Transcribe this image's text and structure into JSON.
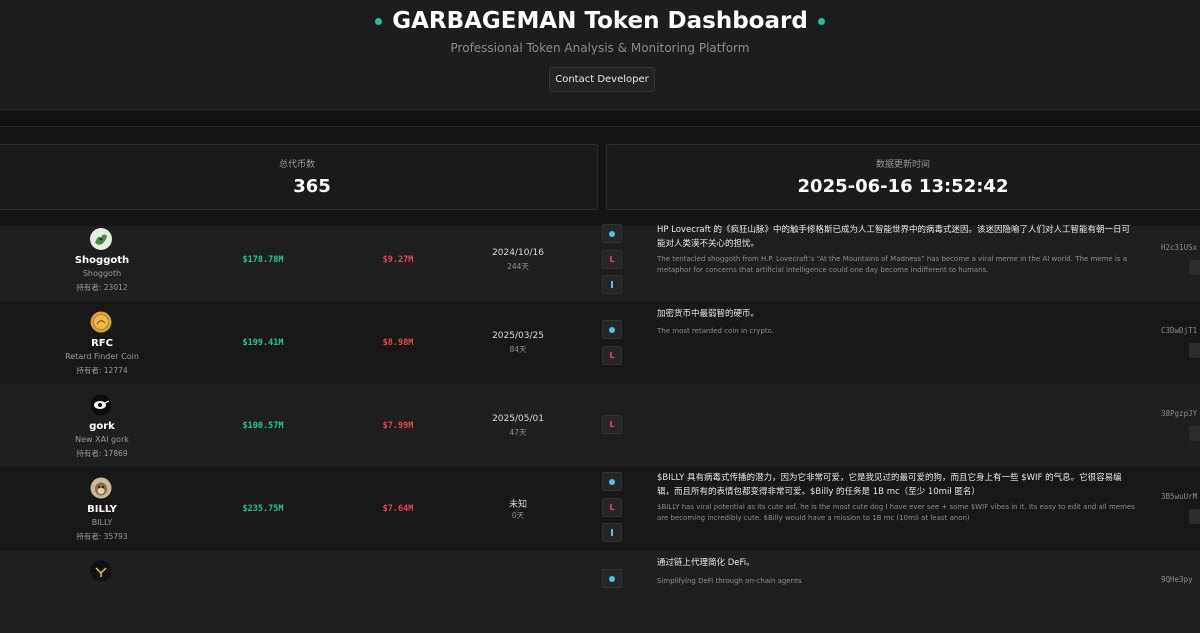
{
  "header": {
    "title": "GARBAGEMAN Token Dashboard",
    "subtitle": "Professional Token Analysis & Monitoring Platform",
    "contact_label": "Contact Developer"
  },
  "stats": {
    "total_label": "总代币数",
    "total_value": "365",
    "updated_label": "数据更新时间",
    "updated_value": "2025-06-16 13:52:42"
  },
  "colors": {
    "accent": "#19c29a",
    "market_cap": "#21c98b",
    "volume": "#e8464f",
    "link_blue": "#4ec6ec"
  },
  "tokens": [
    {
      "name": "Shoggoth",
      "subname": "Shoggoth",
      "holders": "持有者: 23012",
      "market_cap": "$178.78M",
      "volume": "$9.27M",
      "date": "2024/10/16",
      "days": "244天",
      "links": [
        "website-icon",
        "x-icon",
        "telegram-icon"
      ],
      "desc_cn": "HP Lovecraft 的《疯狂山脉》中的触手修格斯已成为人工智能世界中的病毒式迷因。该迷因隐喻了人们对人工智能有朝一日可能对人类漠不关心的担忧。",
      "desc_en": "The tentacled shoggoth from H.P. Lovecraft’s “At the Mountains of Madness” has become a viral meme in the AI world. The meme is a metaphor for concerns that artificial intelligence could one day become indifferent to humans.",
      "address": "H2c31USx"
    },
    {
      "name": "RFC",
      "subname": "Retard Finder Coin",
      "holders": "持有者: 12774",
      "market_cap": "$199.41M",
      "volume": "$8.98M",
      "date": "2025/03/25",
      "days": "84天",
      "links": [
        "website-icon",
        "x-icon"
      ],
      "desc_cn": "加密货币中最弱智的硬币。",
      "desc_en": "The most retarded coin in crypto.",
      "address": "C3DwDjT1"
    },
    {
      "name": "gork",
      "subname": "New XAI gork",
      "holders": "持有者: 17869",
      "market_cap": "$100.57M",
      "volume": "$7.99M",
      "date": "2025/05/01",
      "days": "47天",
      "links": [
        "x-icon"
      ],
      "desc_cn": "",
      "desc_en": "",
      "address": "38PgzpJY"
    },
    {
      "name": "BILLY",
      "subname": "BILLY",
      "holders": "持有者: 35793",
      "market_cap": "$235.75M",
      "volume": "$7.64M",
      "date": "未知",
      "days": "0天",
      "links": [
        "website-icon",
        "x-icon",
        "telegram-icon"
      ],
      "desc_cn": "$BILLY 具有病毒式传播的潜力，因为它非常可爱，它是我见过的最可爱的狗，而且它身上有一些 $WIF 的气息。它很容易编辑，而且所有的表情包都变得非常可爱。$Billy 的任务是 1B mc（至少 10mil 匿名）",
      "desc_en": "$BILLY has viral potential as its cute asf, he is the most cute dog I have ever see + some $WIF vibes in it. Its easy to edit and all memes are becoming incredibly cute. $Billy would have a mission to 1B mc (10mil at least anon)",
      "address": "3B5wuUrM"
    },
    {
      "name": "",
      "subname": "",
      "holders": "",
      "market_cap": "",
      "volume": "",
      "date": "",
      "days": "",
      "links": [
        "website-icon"
      ],
      "desc_cn": "通过链上代理简化 DeFi。",
      "desc_en": "Simplifying DeFi through on-chain agents",
      "address": "9QHe3py"
    }
  ]
}
